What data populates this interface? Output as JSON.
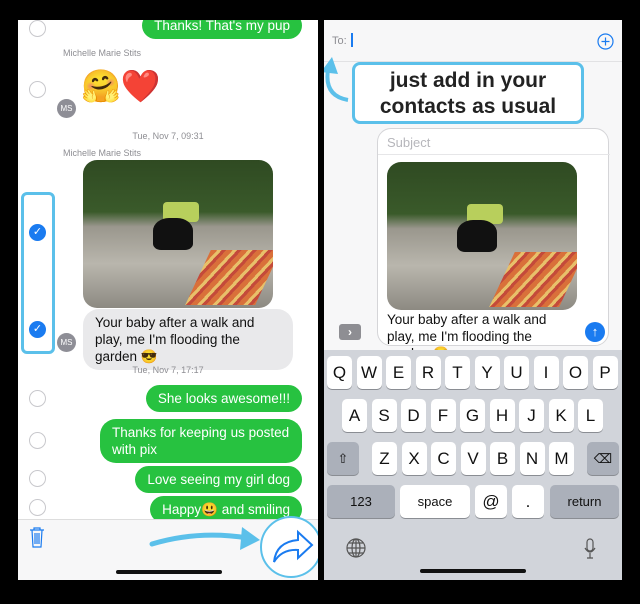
{
  "left": {
    "messages": {
      "pup": "Thanks! That's my pup",
      "sender1": "Michelle Marie Stits",
      "emoji": "🤗❤️",
      "avatar": "MS",
      "stamp1": "Tue, Nov 7, 09:31",
      "sender2": "Michelle Marie Stits",
      "caption": "Your baby after a walk and play, me I'm flooding the garden 😎",
      "stamp2": "Tue, Nov 7, 17:17",
      "m1": "She looks awesome!!!",
      "m2": "Thanks for keeping us posted with pix",
      "m3": "Love seeing my girl dog",
      "m4": "Happy😃 and smiling"
    },
    "checkmark": "✓",
    "toolbar": {
      "delete_icon": "trash-icon",
      "forward_icon": "forward-arrow-icon"
    }
  },
  "right": {
    "to_label": "To:",
    "add_icon": "plus-circle-icon",
    "callout": "just add in your contacts as usual",
    "subject_placeholder": "Subject",
    "caption": "Your baby after a walk and play, me I'm flooding the garden 😎",
    "expand_icon": "chevron-right-icon",
    "send_icon": "arrow-up-icon",
    "keyboard": {
      "row1": [
        "Q",
        "W",
        "E",
        "R",
        "T",
        "Y",
        "U",
        "I",
        "O",
        "P"
      ],
      "row2": [
        "A",
        "S",
        "D",
        "F",
        "G",
        "H",
        "J",
        "K",
        "L"
      ],
      "row3": [
        "Z",
        "X",
        "C",
        "V",
        "B",
        "N",
        "M"
      ],
      "numbers": "123",
      "space": "space",
      "at": "@",
      "dot": ".",
      "return": "return",
      "shift": "⇧",
      "delete": "⌫"
    }
  },
  "colors": {
    "green": "#27c240",
    "blue": "#1a7bf0",
    "callout": "#5bc0ea"
  }
}
